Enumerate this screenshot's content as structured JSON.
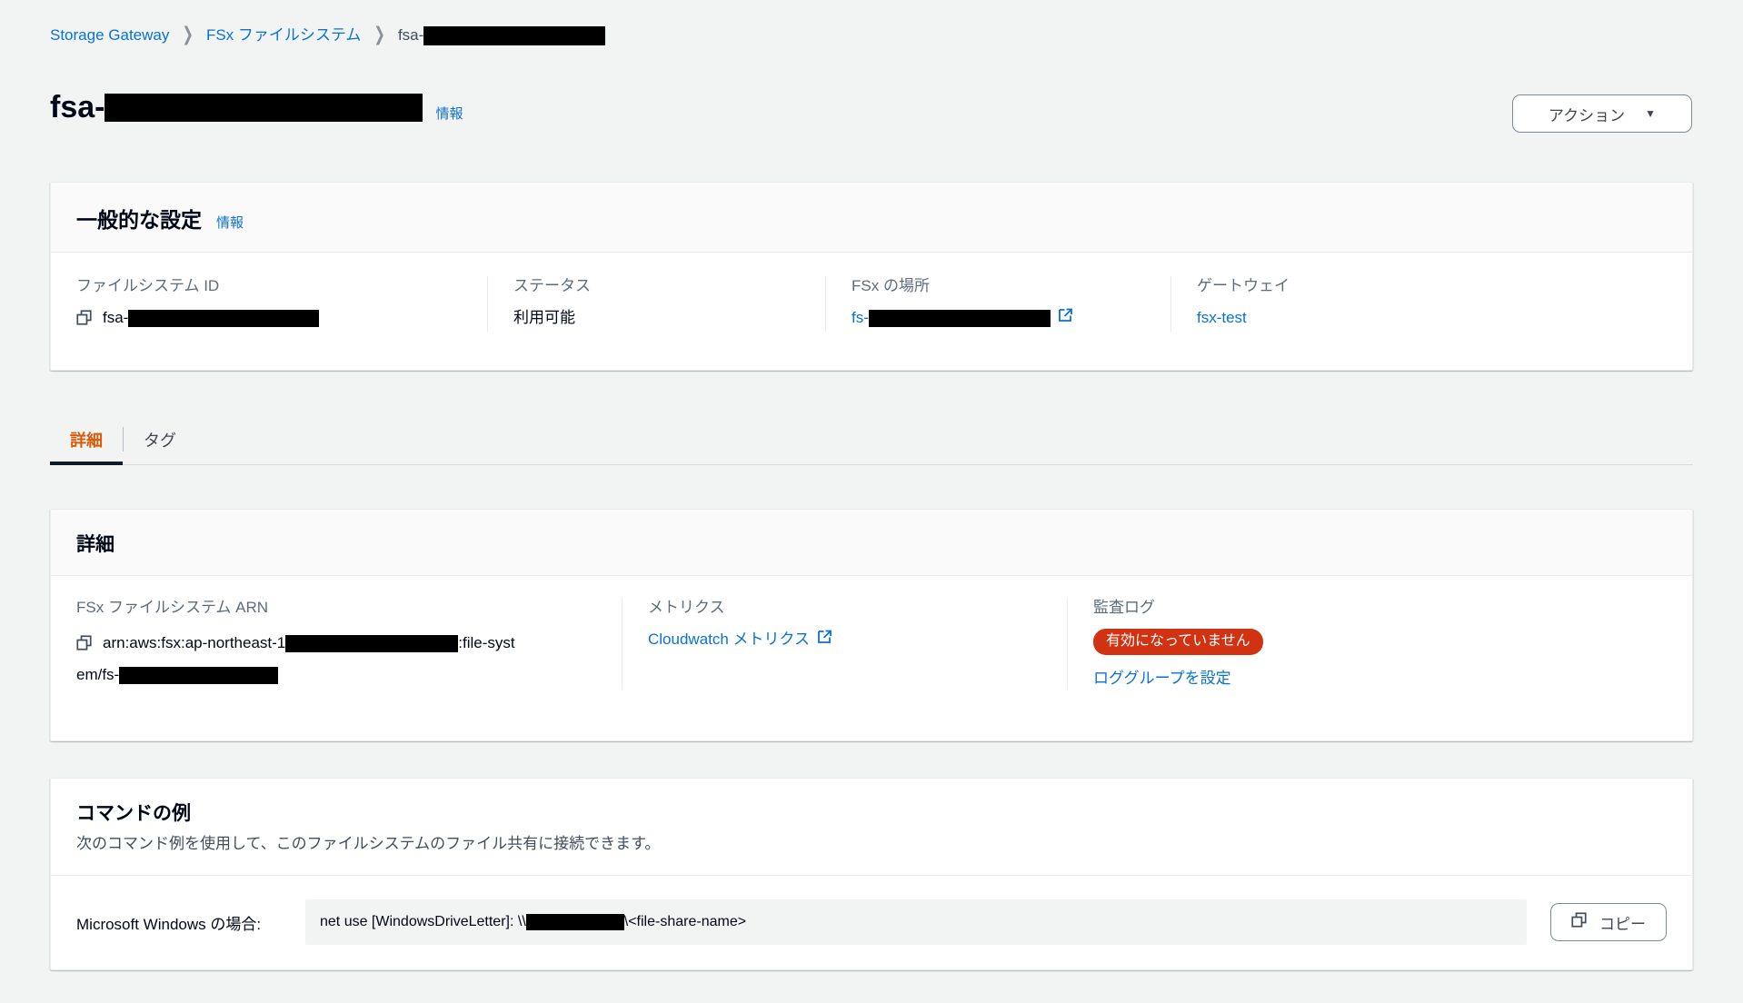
{
  "breadcrumb": {
    "items": [
      {
        "label": "Storage Gateway",
        "type": "link"
      },
      {
        "label": "FSx ファイルシステム",
        "type": "link"
      },
      {
        "label": "fsa-",
        "type": "current",
        "redacted_width": 200
      }
    ],
    "separator": "❯"
  },
  "header": {
    "title_prefix": "fsa-",
    "title_redacted_width": 350,
    "info_label": "情報",
    "actions_button": {
      "label": "アクション",
      "caret": "▼"
    }
  },
  "general_settings": {
    "title": "一般的な設定",
    "info_label": "情報",
    "fields": [
      {
        "label": "ファイルシステム ID",
        "value_prefix": "fsa-",
        "redacted_width": 210,
        "icon": "copy-icon"
      },
      {
        "label": "ステータス",
        "value": "利用可能"
      },
      {
        "label": "FSx の場所",
        "value_prefix": "fs-",
        "redacted_width": 200,
        "link": true,
        "external": true
      },
      {
        "label": "ゲートウェイ",
        "value": "fsx-test",
        "link": true
      }
    ]
  },
  "tabs": [
    {
      "label": "詳細",
      "active": true
    },
    {
      "label": "タグ",
      "active": false
    }
  ],
  "details": {
    "title": "詳細",
    "arn": {
      "label": "FSx ファイルシステム ARN",
      "value_part1": "arn:aws:fsx:ap-northeast-1",
      "redacted_width": 190,
      "value_part2": ":file-syst",
      "value_part3": "em/fs-",
      "redacted_width2": 175,
      "icon": "copy-icon"
    },
    "metrics": {
      "label": "メトリクス",
      "link_label": "Cloudwatch メトリクス",
      "external": true
    },
    "audit_log": {
      "label": "監査ログ",
      "badge": "有効になっていません",
      "badge_color": "#d13212",
      "link_label": "ロググループを設定"
    }
  },
  "command_example": {
    "title": "コマンドの例",
    "description": "次のコマンド例を使用して、このファイルシステムのファイル共有に接続できます。",
    "row": {
      "label": "Microsoft Windows の場合:",
      "command_prefix": "net use [WindowsDriveLetter]: \\\\",
      "redacted_width": 108,
      "command_suffix": "\\<file-share-name>",
      "copy_button": "コピー"
    }
  },
  "colors": {
    "accent_link": "#0972d3",
    "tab_active": "#d45b07",
    "badge_error": "#d13212",
    "page_bg": "#f2f3f3"
  }
}
